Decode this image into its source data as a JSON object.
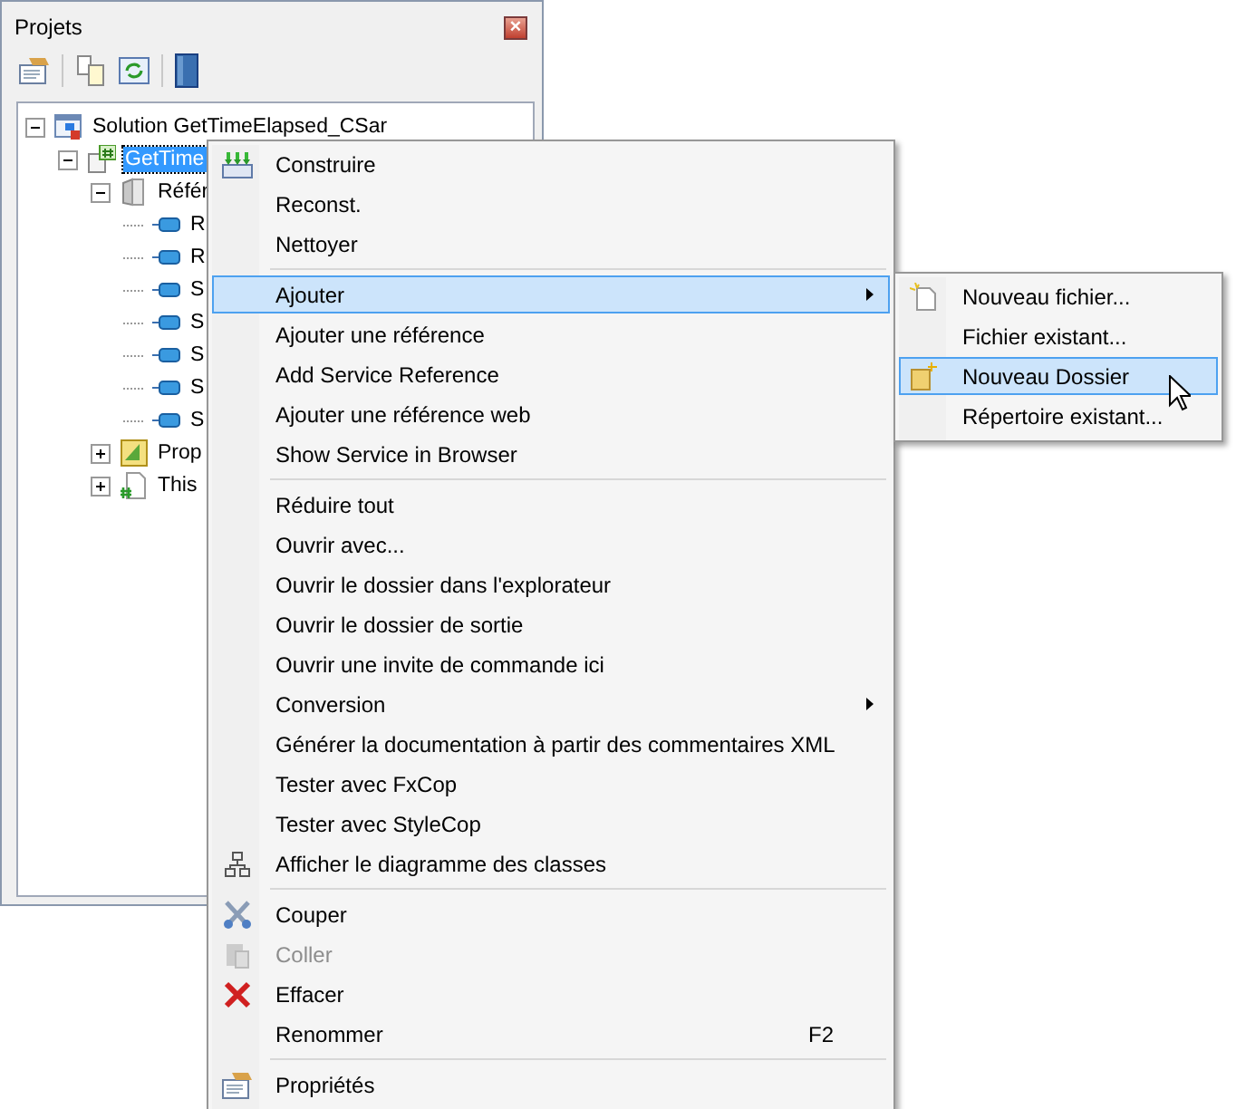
{
  "panel": {
    "title": "Projets",
    "close": "×"
  },
  "tree": [
    {
      "label": "Solution GetTimeElapsed_CSar",
      "kind": "solution",
      "expanded": true,
      "selected": false,
      "children": [
        {
          "label": "GetTime",
          "kind": "project",
          "expanded": true,
          "selected": true,
          "children": [
            {
              "label": "Référ",
              "kind": "references",
              "expanded": true,
              "selected": false,
              "children": [
                {
                  "label": "R",
                  "kind": "reference",
                  "selected": false
                },
                {
                  "label": "R",
                  "kind": "reference",
                  "selected": false
                },
                {
                  "label": "S",
                  "kind": "reference",
                  "selected": false
                },
                {
                  "label": "S",
                  "kind": "reference",
                  "selected": false
                },
                {
                  "label": "S",
                  "kind": "reference",
                  "selected": false
                },
                {
                  "label": "S",
                  "kind": "reference",
                  "selected": false
                },
                {
                  "label": "S",
                  "kind": "reference",
                  "selected": false
                }
              ]
            },
            {
              "label": "Prop",
              "kind": "properties",
              "expanded": false,
              "selected": false
            },
            {
              "label": "This",
              "kind": "csfile",
              "expanded": false,
              "selected": false
            }
          ]
        }
      ]
    }
  ],
  "context_menu": {
    "items": [
      {
        "kind": "item",
        "label": "Construire",
        "selected": false,
        "disabled": false
      },
      {
        "kind": "item",
        "label": "Reconst.",
        "selected": false,
        "disabled": false
      },
      {
        "kind": "item",
        "label": "Nettoyer",
        "selected": false,
        "disabled": false
      },
      {
        "kind": "separator"
      },
      {
        "kind": "item",
        "label": "Ajouter",
        "selected": true,
        "disabled": false,
        "submenu": true
      },
      {
        "kind": "item",
        "label": "Ajouter une référence",
        "selected": false,
        "disabled": false
      },
      {
        "kind": "item",
        "label": "Add Service Reference",
        "selected": false,
        "disabled": false
      },
      {
        "kind": "item",
        "label": "Ajouter une référence web",
        "selected": false,
        "disabled": false
      },
      {
        "kind": "item",
        "label": "Show Service in Browser",
        "selected": false,
        "disabled": false
      },
      {
        "kind": "separator"
      },
      {
        "kind": "item",
        "label": "Réduire tout",
        "selected": false,
        "disabled": false
      },
      {
        "kind": "item",
        "label": "Ouvrir avec...",
        "selected": false,
        "disabled": false
      },
      {
        "kind": "item",
        "label": "Ouvrir le dossier dans l'explorateur",
        "selected": false,
        "disabled": false
      },
      {
        "kind": "item",
        "label": "Ouvrir le dossier de sortie",
        "selected": false,
        "disabled": false
      },
      {
        "kind": "item",
        "label": "Ouvrir une invite de commande ici",
        "selected": false,
        "disabled": false
      },
      {
        "kind": "item",
        "label": "Conversion",
        "selected": false,
        "disabled": false,
        "submenu": true
      },
      {
        "kind": "item",
        "label": "Générer la documentation à partir des commentaires XML",
        "selected": false,
        "disabled": false
      },
      {
        "kind": "item",
        "label": "Tester avec FxCop",
        "selected": false,
        "disabled": false
      },
      {
        "kind": "item",
        "label": "Tester avec StyleCop",
        "selected": false,
        "disabled": false
      },
      {
        "kind": "item",
        "label": "Afficher le diagramme des classes",
        "selected": false,
        "disabled": false
      },
      {
        "kind": "separator"
      },
      {
        "kind": "item",
        "label": "Couper",
        "selected": false,
        "disabled": false
      },
      {
        "kind": "item",
        "label": "Coller",
        "selected": false,
        "disabled": true
      },
      {
        "kind": "item",
        "label": "Effacer",
        "selected": false,
        "disabled": false
      },
      {
        "kind": "item",
        "label": "Renommer",
        "selected": false,
        "disabled": false,
        "shortcut": "F2"
      },
      {
        "kind": "separator"
      },
      {
        "kind": "item",
        "label": "Propriétés",
        "selected": false,
        "disabled": false
      }
    ]
  },
  "submenu": {
    "items": [
      {
        "label": "Nouveau fichier...",
        "selected": false
      },
      {
        "label": "Fichier existant...",
        "selected": false
      },
      {
        "label": "Nouveau Dossier",
        "selected": true
      },
      {
        "label": "Répertoire existant...",
        "selected": false
      }
    ]
  }
}
